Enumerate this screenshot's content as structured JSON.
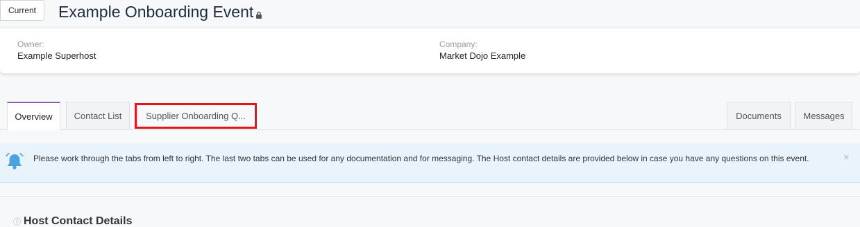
{
  "header": {
    "status": "Current",
    "title": "Example Onboarding Event"
  },
  "info": {
    "owner_label": "Owner:",
    "owner_value": "Example Superhost",
    "company_label": "Company:",
    "company_value": "Market Dojo Example"
  },
  "tabs": {
    "left": [
      {
        "label": "Overview",
        "active": true
      },
      {
        "label": "Contact List",
        "active": false
      },
      {
        "label": "Supplier Onboarding Q...",
        "active": false,
        "highlighted": true
      }
    ],
    "right": [
      {
        "label": "Documents"
      },
      {
        "label": "Messages"
      }
    ]
  },
  "alert": {
    "text": "Please work through the tabs from left to right. The last two tabs can be used for any documentation and for messaging. The Host contact details are provided below in case you have any questions on this event.",
    "close": "×",
    "icon": "bell-icon"
  },
  "section": {
    "title": "Host Contact Details",
    "icon": "info-icon"
  },
  "colors": {
    "accent": "#8a5bb5",
    "highlight": "#e3141a",
    "alert_bg": "#e8f3fb",
    "bell": "#4aa3df"
  }
}
